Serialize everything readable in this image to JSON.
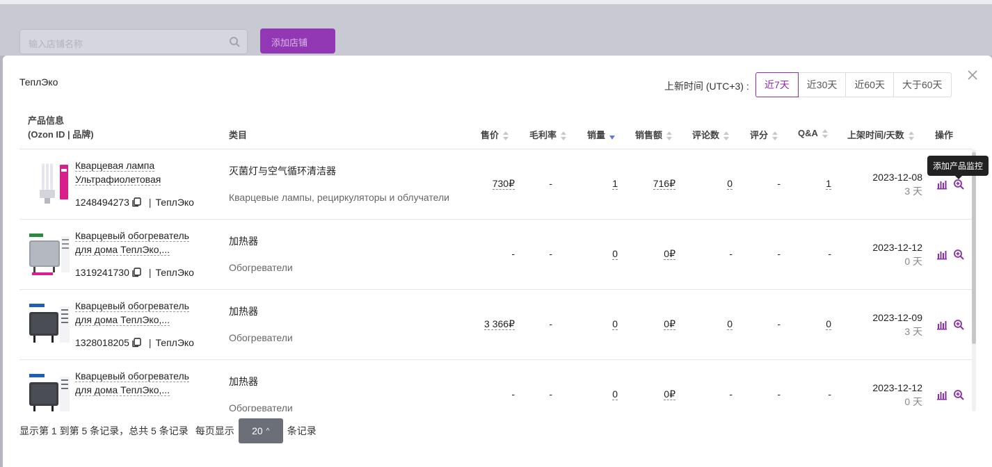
{
  "background": {
    "search_placeholder": "输入店铺名称",
    "add_button_label": "添加店铺"
  },
  "modal": {
    "shop_name": "ТеплЭко",
    "filter": {
      "label": "上新时间 (UTC+3) :",
      "options": [
        "近7天",
        "近30天",
        "近60天",
        "大于60天"
      ],
      "active": "近7天"
    },
    "columns": {
      "product_info_line1": "产品信息",
      "product_info_line2": "(Ozon ID | 品牌)",
      "category": "类目",
      "price": "售价",
      "margin": "毛利率",
      "sales": "销量",
      "revenue": "销售额",
      "reviews": "评论数",
      "rating": "评分",
      "qa": "Q&A",
      "listed": "上架时间/天数",
      "actions": "操作"
    },
    "rows": [
      {
        "name_line1": "Кварцевая лампа",
        "name_line2": "Ультрафиолетовая",
        "ozon_id": "1248494273",
        "brand": "ТеплЭко",
        "category_cn": "灭菌灯与空气循环清洁器",
        "category_ru": "Кварцевые лампы, рециркуляторы и облучатели",
        "price": "730₽",
        "margin": "-",
        "sales": "1",
        "revenue": "716₽",
        "reviews": "0",
        "rating": "-",
        "qa": "1",
        "date": "2023-12-08",
        "days": "3 天",
        "thumb": "lamp"
      },
      {
        "name_line1": "Кварцевый обогреватель",
        "name_line2": "для дома ТеплЭко,...",
        "ozon_id": "1319241730",
        "brand": "ТеплЭко",
        "category_cn": "加热器",
        "category_ru": "Обогреватели",
        "price": "-",
        "margin": "-",
        "sales": "0",
        "revenue": "0₽",
        "reviews": "-",
        "rating": "-",
        "qa": "-",
        "date": "2023-12-12",
        "days": "0 天",
        "thumb": "heater-gray"
      },
      {
        "name_line1": "Кварцевый обогреватель",
        "name_line2": "для дома ТеплЭко,...",
        "ozon_id": "1328018205",
        "brand": "ТеплЭко",
        "category_cn": "加热器",
        "category_ru": "Обогреватели",
        "price": "3 366₽",
        "margin": "-",
        "sales": "0",
        "revenue": "0₽",
        "reviews": "0",
        "rating": "-",
        "qa": "0",
        "date": "2023-12-09",
        "days": "3 天",
        "thumb": "heater-dark"
      },
      {
        "name_line1": "Кварцевый обогреватель",
        "name_line2": "для дома ТеплЭко,...",
        "ozon_id": "",
        "brand": "",
        "category_cn": "加热器",
        "category_ru": "Обогреватели",
        "price": "-",
        "margin": "-",
        "sales": "0",
        "revenue": "0₽",
        "reviews": "-",
        "rating": "-",
        "qa": "-",
        "date": "2023-12-12",
        "days": "0 天",
        "thumb": "heater-dark"
      }
    ],
    "tooltip": "添加产品监控",
    "footer": {
      "summary": "显示第 1 到第 5 条记录，总共 5 条记录",
      "per_page_label": "每页显示",
      "page_size": "20",
      "records_label": "条记录"
    },
    "colors": {
      "accent": "#8a2da8",
      "sort_active": "#5b7bd6"
    }
  }
}
